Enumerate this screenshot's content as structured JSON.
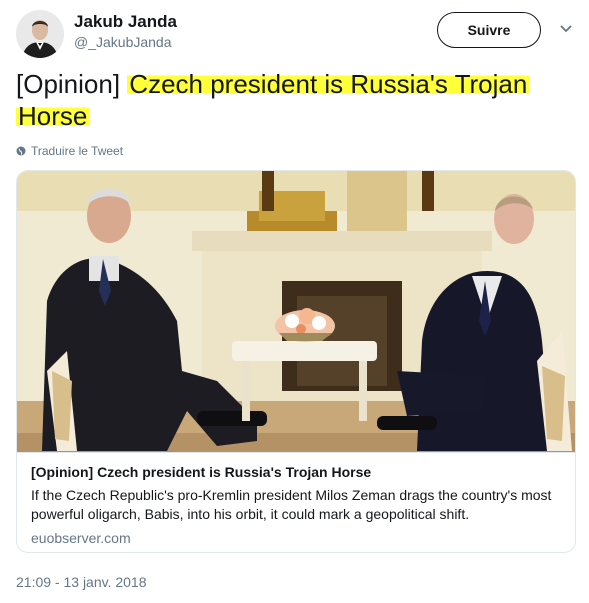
{
  "user": {
    "name": "Jakub Janda",
    "handle": "@_JakubJanda"
  },
  "follow_button": {
    "label": "Suivre"
  },
  "tweet": {
    "prefix": "[Opinion] ",
    "highlight_1": "Czech president is Russia's Trojan",
    "highlight_2": "Horse",
    "translate_label": "Traduire le Tweet",
    "timestamp": "21:09 - 13 janv. 2018"
  },
  "card": {
    "title": "[Opinion] Czech president is Russia's Trojan Horse",
    "description": "If the Czech Republic's pro-Kremlin president Milos Zeman drags the country's most powerful oligarch, Babis, into his orbit, it could mark a geopolitical shift.",
    "domain": "euobserver.com"
  },
  "colors": {
    "highlight": "#ffff3a",
    "muted_text": "#657786",
    "border": "#e1e8ed"
  }
}
